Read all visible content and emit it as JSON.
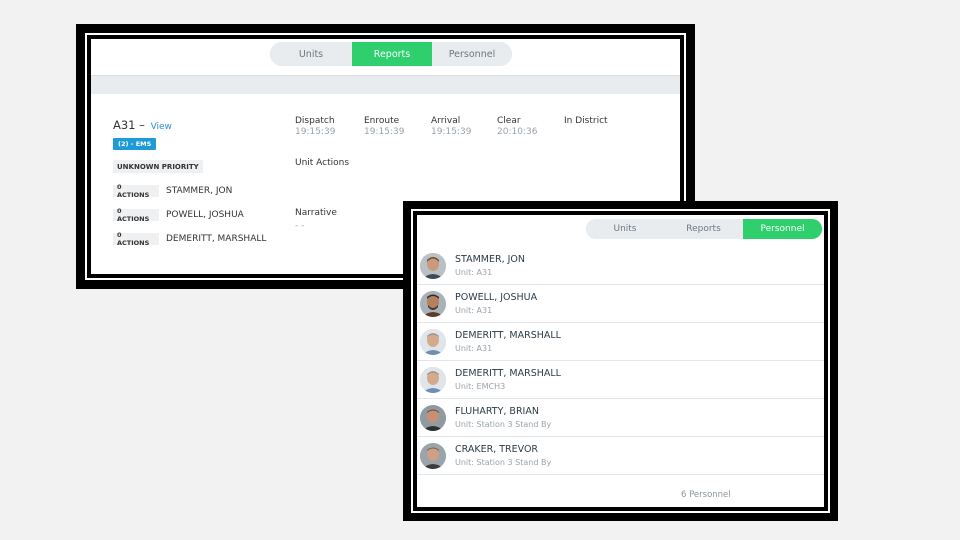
{
  "report": {
    "tabs": [
      "Units",
      "Reports",
      "Personnel"
    ],
    "active_tab": "Reports",
    "unit_name": "A31 –",
    "view_link": "View",
    "ems_badge": "(2) - EMS",
    "priority": "UNKNOWN PRIORITY",
    "personnel": [
      {
        "actions": "0 ACTIONS",
        "name": "STAMMER, JON"
      },
      {
        "actions": "0 ACTIONS",
        "name": "POWELL, JOSHUA"
      },
      {
        "actions": "0 ACTIONS",
        "name": "DEMERITT, MARSHALL"
      }
    ],
    "timestamps": [
      {
        "label": "Dispatch",
        "value": "19:15:39"
      },
      {
        "label": "Enroute",
        "value": "19:15:39"
      },
      {
        "label": "Arrival",
        "value": "19:15:39"
      },
      {
        "label": "Clear",
        "value": "20:10:36"
      },
      {
        "label": "In District",
        "value": ""
      }
    ],
    "unit_actions_label": "Unit Actions",
    "narrative_label": "Narrative",
    "narrative_value": "- -"
  },
  "personnel_panel": {
    "tabs": [
      "Units",
      "Reports",
      "Personnel"
    ],
    "active_tab": "Personnel",
    "items": [
      {
        "name": "STAMMER, JON",
        "unit": "Unit: A31",
        "avatar": "photo-avatar-icon"
      },
      {
        "name": "POWELL, JOSHUA",
        "unit": "Unit: A31",
        "avatar": "photo-avatar-icon"
      },
      {
        "name": "DEMERITT, MARSHALL",
        "unit": "Unit: A31",
        "avatar": "photo-avatar-icon"
      },
      {
        "name": "DEMERITT, MARSHALL",
        "unit": "Unit: EMCH3",
        "avatar": "photo-avatar-icon"
      },
      {
        "name": "FLUHARTY, BRIAN",
        "unit": "Unit: Station 3 Stand By",
        "avatar": "photo-avatar-icon"
      },
      {
        "name": "CRAKER, TREVOR",
        "unit": "Unit: Station 3 Stand By",
        "avatar": "photo-avatar-icon"
      }
    ],
    "count_label": "6 Personnel"
  },
  "colors": {
    "accent_green": "#2fcf6e",
    "ems_blue": "#1e9ad6",
    "link_blue": "#2b8fd6"
  }
}
